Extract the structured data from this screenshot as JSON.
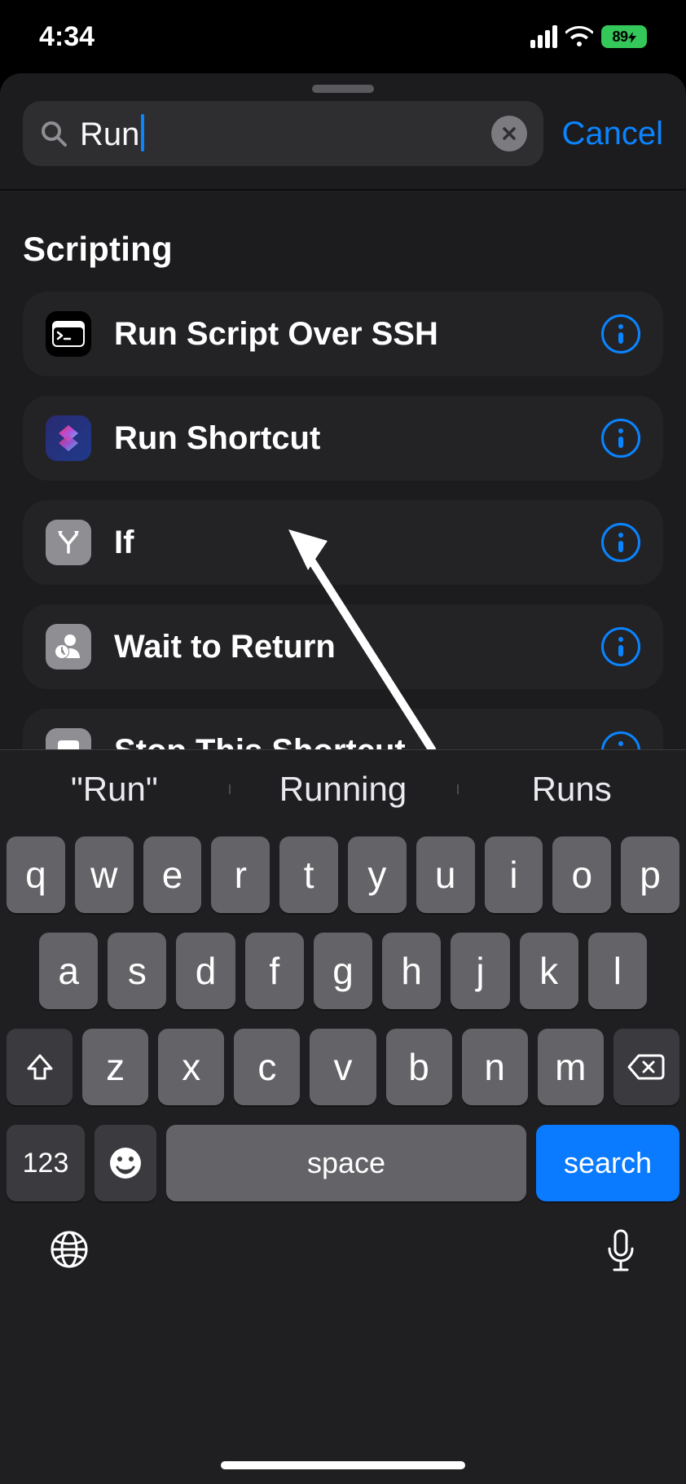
{
  "status": {
    "time": "4:34",
    "battery": "89"
  },
  "search": {
    "value": "Run",
    "cancel": "Cancel"
  },
  "section": {
    "title": "Scripting"
  },
  "actions": [
    {
      "label": "Run Script Over SSH"
    },
    {
      "label": "Run Shortcut"
    },
    {
      "label": "If"
    },
    {
      "label": "Wait to Return"
    },
    {
      "label": "Stop This Shortcut"
    }
  ],
  "suggestions": [
    "\"Run\"",
    "Running",
    "Runs"
  ],
  "keyboard": {
    "row1": [
      "q",
      "w",
      "e",
      "r",
      "t",
      "y",
      "u",
      "i",
      "o",
      "p"
    ],
    "row2": [
      "a",
      "s",
      "d",
      "f",
      "g",
      "h",
      "j",
      "k",
      "l"
    ],
    "row3": [
      "z",
      "x",
      "c",
      "v",
      "b",
      "n",
      "m"
    ],
    "numbers": "123",
    "space": "space",
    "action": "search"
  }
}
